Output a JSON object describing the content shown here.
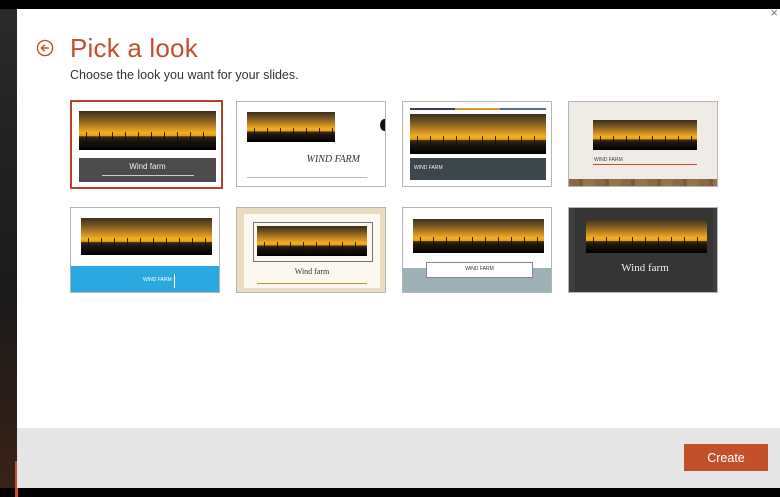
{
  "dialog": {
    "title": "Pick a look",
    "subtitle": "Choose the look you want for your slides.",
    "create_label": "Create"
  },
  "themes": [
    {
      "label": "Wind farm"
    },
    {
      "label": "WIND FARM"
    },
    {
      "label": "WIND FARM"
    },
    {
      "label": "WIND FARM"
    },
    {
      "label": "WIND FARM"
    },
    {
      "label": "Wind farm"
    },
    {
      "label": "WIND FARM"
    },
    {
      "label": "Wind farm"
    }
  ],
  "colors": {
    "accent": "#c3502c",
    "selected_border": "#b4432a"
  },
  "selected_theme_index": 0
}
